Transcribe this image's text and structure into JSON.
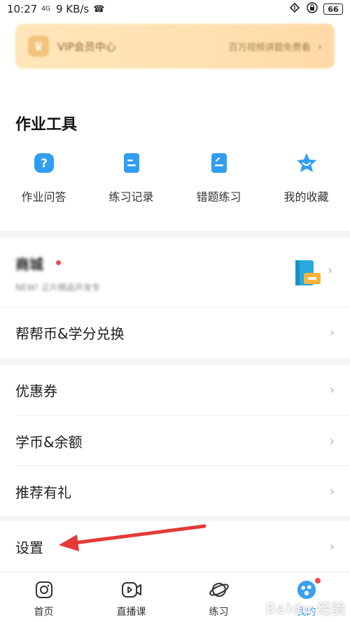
{
  "status_bar": {
    "time": "10:27",
    "network_type": "4G",
    "speed": "9 KB/s",
    "battery": "66"
  },
  "vip": {
    "title": "VIP会员中心",
    "subtitle": "百万视频讲题免费看",
    "chevron": "›"
  },
  "tools": {
    "title": "作业工具",
    "items": [
      {
        "label": "作业问答",
        "icon": "question-icon"
      },
      {
        "label": "练习记录",
        "icon": "record-icon"
      },
      {
        "label": "错题练习",
        "icon": "mistake-icon"
      },
      {
        "label": "我的收藏",
        "icon": "star-icon"
      }
    ]
  },
  "shop": {
    "title": "商城",
    "subtitle": "NEW! 正片精品开发专",
    "chevron": "›"
  },
  "menu": {
    "exchange": "帮帮币&学分兑换",
    "coupon": "优惠券",
    "balance": "学币&余额",
    "referral": "推荐有礼",
    "settings": "设置",
    "chevron": "›"
  },
  "tabbar": {
    "items": [
      {
        "label": "首页",
        "icon": "home-icon"
      },
      {
        "label": "直播课",
        "icon": "live-icon"
      },
      {
        "label": "练习",
        "icon": "practice-icon"
      },
      {
        "label": "我的",
        "icon": "profile-icon",
        "active": true
      }
    ]
  },
  "watermark": "Baidu 经验",
  "colors": {
    "accent": "#3aa0f0",
    "red": "#f24b4b",
    "vip_gold": "#ffe2b3"
  }
}
